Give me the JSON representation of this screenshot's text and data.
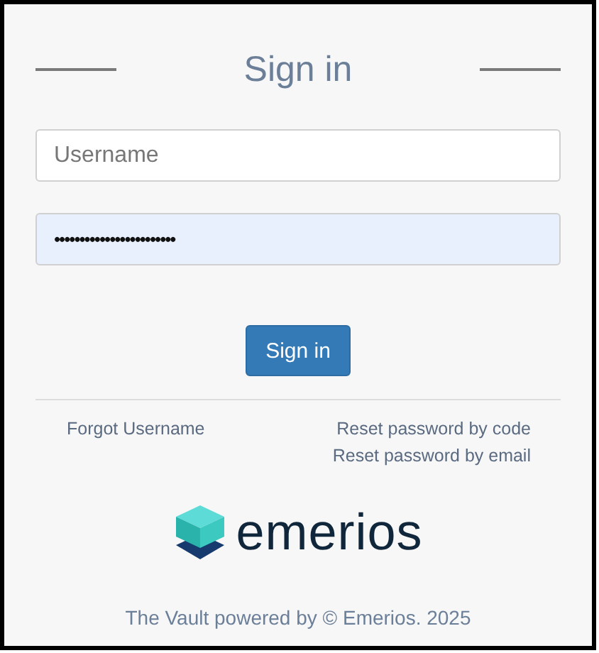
{
  "title": "Sign in",
  "username": {
    "placeholder": "Username"
  },
  "password": {
    "value": "••••••••••••••••••••••••",
    "autofilled": true
  },
  "submit": {
    "label": "Sign in"
  },
  "links_left": [
    "Forgot Username"
  ],
  "links_right": [
    "Reset password by code",
    "Reset password by email"
  ],
  "logo": {
    "text": "emerios"
  },
  "footer": "The Vault powered by © Emerios. 2025"
}
